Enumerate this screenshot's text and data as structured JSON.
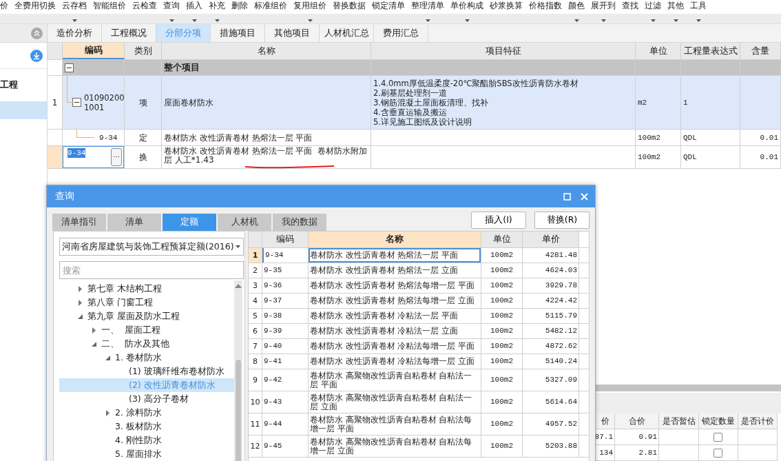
{
  "toolbar": {
    "items": [
      {
        "label": "价",
        "menu": false
      },
      {
        "label": "全费用切换",
        "menu": false
      },
      {
        "label": "云存档",
        "menu": true
      },
      {
        "label": "智能组价",
        "menu": false
      },
      {
        "label": "云检查",
        "menu": false
      },
      {
        "label": "查询",
        "menu": true
      },
      {
        "label": "插入",
        "menu": true
      },
      {
        "label": "补充",
        "menu": true
      },
      {
        "label": "删除",
        "menu": false
      },
      {
        "label": "标准组价",
        "menu": false
      },
      {
        "label": "复用组价",
        "menu": true
      },
      {
        "label": "替换数据",
        "menu": false
      },
      {
        "label": "锁定清单",
        "menu": false
      },
      {
        "label": "整理清单",
        "menu": true
      },
      {
        "label": "单价构成",
        "menu": true
      },
      {
        "label": "砂浆换算",
        "menu": false
      },
      {
        "label": "价格指数",
        "menu": false
      },
      {
        "label": "颜色",
        "menu": true
      },
      {
        "label": "展开到",
        "menu": true
      },
      {
        "label": "查找",
        "menu": false
      },
      {
        "label": "过滤",
        "menu": true
      },
      {
        "label": "其他",
        "menu": true
      },
      {
        "label": "工具",
        "menu": true
      }
    ]
  },
  "sidebar": {
    "label": "工程"
  },
  "tabs": [
    {
      "label": "造价分析",
      "selected": false
    },
    {
      "label": "工程概况",
      "selected": false
    },
    {
      "label": "分部分项",
      "selected": true
    },
    {
      "label": "措施项目",
      "selected": false
    },
    {
      "label": "其他项目",
      "selected": false
    },
    {
      "label": "人材机汇总",
      "selected": false
    },
    {
      "label": "费用汇总",
      "selected": false
    }
  ],
  "table": {
    "columns": [
      {
        "label": "编码",
        "selected": true
      },
      {
        "label": "类别",
        "selected": false
      },
      {
        "label": "名称",
        "selected": false
      },
      {
        "label": "项目特征",
        "selected": false
      },
      {
        "label": "单位",
        "selected": false
      },
      {
        "label": "工程量表达式",
        "selected": false
      },
      {
        "label": "含量",
        "selected": false
      }
    ],
    "rows": [
      {
        "kind": "group",
        "expanded": true,
        "name": "整个项目"
      },
      {
        "kind": "item",
        "expanded": true,
        "number": "1",
        "code": "010902001001",
        "type": "项",
        "name": "屋面卷材防水",
        "features": [
          "1.4.0mm厚低温柔度-20℃聚酯胎SBS改性沥青防水卷材",
          "2.刷基层处理剂一道",
          "3.钢筋混凝土屋面板清理、找补",
          "4.含垂直运输及搬运",
          "5.详见施工图纸及设计说明"
        ],
        "unit": "m2",
        "expression": "1"
      },
      {
        "kind": "quota",
        "code": "9-34",
        "type": "定",
        "name": "卷材防水 改性沥青卷材 热熔法一层 平面",
        "unit": "100m2",
        "expression": "QDL",
        "content": "0.01"
      },
      {
        "kind": "edit",
        "code": "9-34",
        "more": "⋯",
        "type": "换",
        "name": "卷材防水 改性沥青卷材 热熔法一层 平面  卷材防水附加层 人工*1.43",
        "unit": "100m2",
        "expression": "QDL",
        "content": "0.01"
      }
    ]
  },
  "detail": {
    "columns": [
      "价",
      "合价",
      "是否暂估",
      "锁定数量",
      "是否计价"
    ],
    "rows": [
      {
        "price": "87.1",
        "total": "0.91",
        "locked": false
      },
      {
        "price": "134",
        "total": "2.81",
        "locked": false
      }
    ]
  },
  "dialog": {
    "title": "查询",
    "tabs": [
      {
        "label": "清单指引",
        "selected": false
      },
      {
        "label": "清单",
        "selected": false
      },
      {
        "label": "定额",
        "selected": true
      },
      {
        "label": "人材机",
        "selected": false
      },
      {
        "label": "我的数据",
        "selected": false
      }
    ],
    "buttons": [
      "插入(I)",
      "替换(R)"
    ],
    "library": "河南省房屋建筑与装饰工程预算定额(2016)",
    "search": {
      "placeholder": "搜索"
    },
    "tree": [
      {
        "label": "第七章 木结构工程",
        "expanded": false,
        "selected": false
      },
      {
        "label": "第八章 门窗工程",
        "expanded": false,
        "selected": false
      },
      {
        "label": "第九章 屋面及防水工程",
        "expanded": true,
        "selected": false,
        "children": [
          {
            "label": "一、  屋面工程",
            "expanded": false,
            "selected": false
          },
          {
            "label": "二、  防水及其他",
            "expanded": true,
            "selected": false,
            "children": [
              {
                "label": "1. 卷材防水",
                "expanded": true,
                "selected": false,
                "children": [
                  {
                    "label": "(1) 玻璃纤维布卷材防水",
                    "selected": false
                  },
                  {
                    "label": "(2) 改性沥青卷材防水",
                    "selected": true
                  },
                  {
                    "label": "(3) 高分子卷材",
                    "selected": false
                  }
                ]
              },
              {
                "label": "2. 涂料防水",
                "expanded": false,
                "selected": false
              },
              {
                "label": "3. 板材防水",
                "selected": false
              },
              {
                "label": "4. 刚性防水",
                "selected": false
              },
              {
                "label": "5. 屋面排水",
                "selected": false
              }
            ]
          }
        ]
      }
    ],
    "results": {
      "columns": [
        {
          "label": "编码",
          "selected": false
        },
        {
          "label": "名称",
          "selected": true
        },
        {
          "label": "单位",
          "selected": false
        },
        {
          "label": "单价",
          "selected": false
        }
      ],
      "rows": [
        {
          "number": "1",
          "code": "9-34",
          "name": "卷材防水 改性沥青卷材 热熔法一层 平面",
          "unit": "100m2",
          "price": "4281.48",
          "selected": true
        },
        {
          "number": "2",
          "code": "9-35",
          "name": "卷材防水 改性沥青卷材 热熔法一层 立面",
          "unit": "100m2",
          "price": "4624.03",
          "selected": false
        },
        {
          "number": "3",
          "code": "9-36",
          "name": "卷材防水 改性沥青卷材 热熔法每增一层 平面",
          "unit": "100m2",
          "price": "3929.78",
          "selected": false
        },
        {
          "number": "4",
          "code": "9-37",
          "name": "卷材防水 改性沥青卷材 热熔法每增一层 立面",
          "unit": "100m2",
          "price": "4224.42",
          "selected": false
        },
        {
          "number": "5",
          "code": "9-38",
          "name": "卷材防水 改性沥青卷材 冷粘法一层 平面",
          "unit": "100m2",
          "price": "5115.79",
          "selected": false
        },
        {
          "number": "6",
          "code": "9-39",
          "name": "卷材防水 改性沥青卷材 冷粘法一层 立面",
          "unit": "100m2",
          "price": "5482.12",
          "selected": false
        },
        {
          "number": "7",
          "code": "9-40",
          "name": "卷材防水 改性沥青卷材 冷粘法每增一层 平面",
          "unit": "100m2",
          "price": "4872.62",
          "selected": false
        },
        {
          "number": "8",
          "code": "9-41",
          "name": "卷材防水 改性沥青卷材 冷粘法每增一层 立面",
          "unit": "100m2",
          "price": "5140.24",
          "selected": false
        },
        {
          "number": "9",
          "code": "9-42",
          "name": "卷材防水 高聚物改性沥青自粘卷材 自粘法一层 平面",
          "unit": "100m2",
          "price": "5327.09",
          "selected": false
        },
        {
          "number": "10",
          "code": "9-43",
          "name": "卷材防水 高聚物改性沥青自粘卷材 自粘法一层 立面",
          "unit": "100m2",
          "price": "5614.64",
          "selected": false
        },
        {
          "number": "11",
          "code": "9-44",
          "name": "卷材防水 高聚物改性沥青自粘卷材 自粘法每增一层 平面",
          "unit": "100m2",
          "price": "4957.52",
          "selected": false
        },
        {
          "number": "12",
          "code": "9-45",
          "name": "卷材防水 高聚物改性沥青自粘卷材 自粘法每增一层 立面",
          "unit": "100m2",
          "price": "5203.88",
          "selected": false
        }
      ]
    }
  }
}
